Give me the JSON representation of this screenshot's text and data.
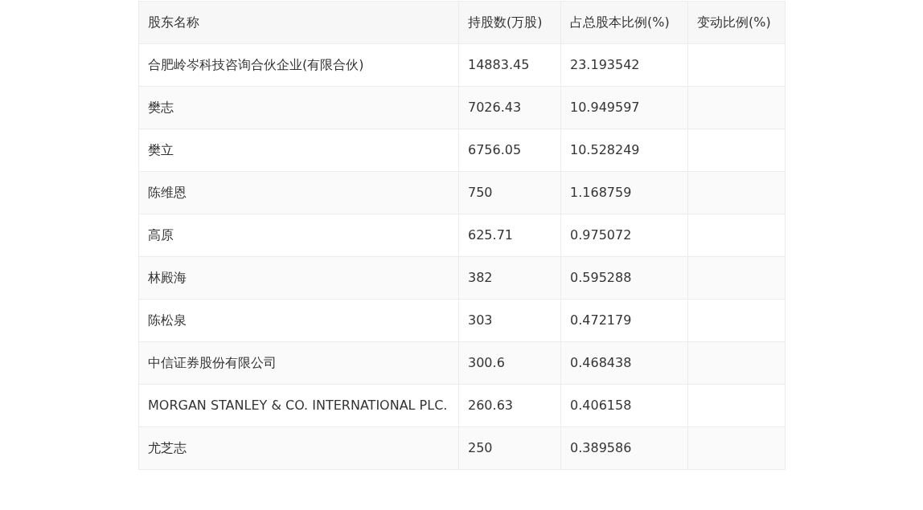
{
  "table": {
    "columns": [
      "股东名称",
      "持股数(万股)",
      "占总股本比例(%)",
      "变动比例(%)"
    ],
    "rows": [
      {
        "name": "合肥岭岑科技咨询合伙企业(有限合伙)",
        "shares": "14883.45",
        "ratio": "23.193542"
      },
      {
        "name": "樊志",
        "shares": "7026.43",
        "ratio": "10.949597"
      },
      {
        "name": "樊立",
        "shares": "6756.05",
        "ratio": "10.528249"
      },
      {
        "name": "陈维恩",
        "shares": "750",
        "ratio": "1.168759"
      },
      {
        "name": "高原",
        "shares": "625.71",
        "ratio": "0.975072"
      },
      {
        "name": "林殿海",
        "shares": "382",
        "ratio": "0.595288"
      },
      {
        "name": "陈松泉",
        "shares": "303",
        "ratio": "0.472179"
      },
      {
        "name": "中信证券股份有限公司",
        "shares": "300.6",
        "ratio": "0.468438"
      },
      {
        "name": "MORGAN STANLEY & CO. INTERNATIONAL PLC.",
        "shares": "260.63",
        "ratio": "0.406158"
      },
      {
        "name": "尤芝志",
        "shares": "250",
        "ratio": "0.389586"
      }
    ]
  }
}
